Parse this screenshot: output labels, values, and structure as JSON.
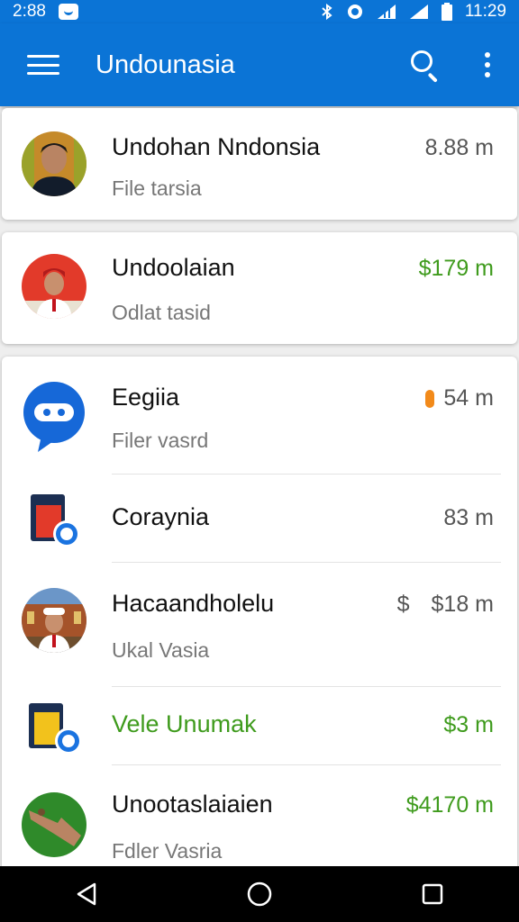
{
  "status_bar": {
    "time_left": "2:88",
    "time_right": "11:29"
  },
  "app_bar": {
    "title": "Undounasia"
  },
  "items": [
    {
      "title": "Undohan Nndonsia",
      "subtitle": "File tarsia",
      "meta": "8.88 m",
      "meta_color": "#555555",
      "icon": "avatar-man-photo"
    },
    {
      "title": "Undoolaian",
      "subtitle": "Odlat tasid",
      "meta": "$179 m",
      "meta_color": "#3f9b1d",
      "icon": "avatar-red-hat"
    },
    {
      "title": "Eegiia",
      "subtitle": "Filer vasrd",
      "meta": "54 m",
      "meta_color": "#555555",
      "icon": "chat-bubble-icon"
    },
    {
      "title": "Coraynia",
      "subtitle": "",
      "meta": "83 m",
      "meta_color": "#555555",
      "icon": "red-folder-icon"
    },
    {
      "title": "Hacaandholelu",
      "subtitle": "Ukal Vasia",
      "meta_prefix": "$",
      "meta": "$18 m",
      "meta_color": "#555555",
      "icon": "avatar-building"
    },
    {
      "title": "Vele Unumak",
      "subtitle": "",
      "meta": "$3 m",
      "meta_color": "#3f9b1d",
      "icon": "yellow-folder-icon"
    },
    {
      "title": "Unootaslaiaien",
      "subtitle": "Fdler Vasria",
      "meta": "$4170 m",
      "meta_color": "#3f9b1d",
      "icon": "avatar-green-hand"
    }
  ],
  "colors": {
    "primary": "#0b74d6",
    "green": "#3f9b1d",
    "orange": "#f28a1a"
  }
}
